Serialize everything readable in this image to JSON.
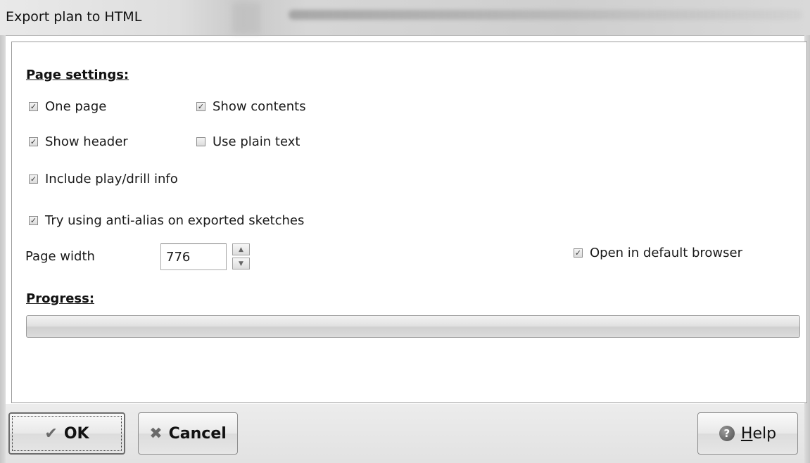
{
  "window": {
    "title": "Export plan to HTML"
  },
  "page_settings": {
    "heading": "Page settings:",
    "one_page": {
      "label": "One page",
      "checked": true
    },
    "show_contents": {
      "label": "Show contents",
      "checked": true
    },
    "show_header": {
      "label": "Show header",
      "checked": true
    },
    "use_plain_text": {
      "label": "Use plain text",
      "checked": false
    },
    "include_play_drill_info": {
      "label": "Include play/drill info",
      "checked": true
    },
    "anti_alias": {
      "label": "Try using anti-alias on exported sketches",
      "checked": true
    },
    "page_width": {
      "label": "Page width",
      "value": "776"
    },
    "open_in_browser": {
      "label": "Open in default browser",
      "checked": true
    }
  },
  "progress": {
    "heading": "Progress:",
    "value": 0
  },
  "buttons": {
    "ok": "OK",
    "cancel": "Cancel",
    "help_hotkey": "H",
    "help_rest": "elp"
  },
  "icons": {
    "check": "checkmark-icon",
    "cancel": "x-icon",
    "help": "question-icon",
    "spin_up": "triangle-up-icon",
    "spin_down": "triangle-down-icon"
  },
  "colors": {
    "progress_fill": "#5fbf5f"
  }
}
